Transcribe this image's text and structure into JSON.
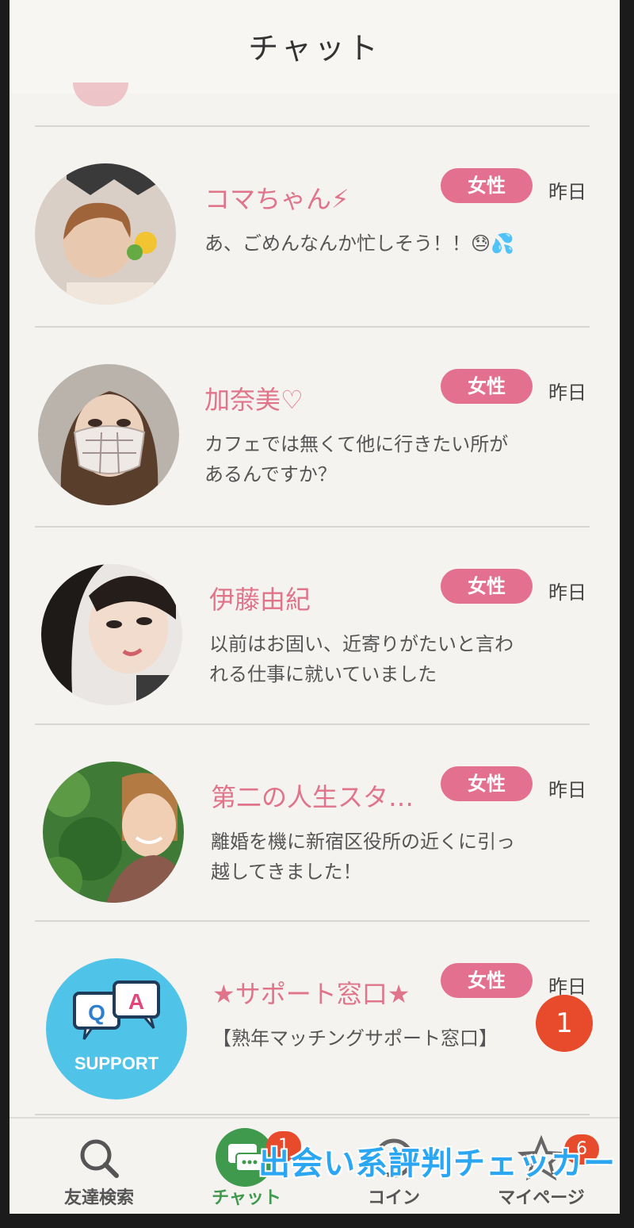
{
  "header": {
    "title": "チャット"
  },
  "badge_label": "女性",
  "chats": [
    {
      "name": "コマちゃん⚡",
      "date": "昨日",
      "message": "あ、ごめんなんか忙しそう！！😓💦"
    },
    {
      "name": "加奈美♡",
      "date": "昨日",
      "message": "カフェでは無くて他に行きたい所があるんですか？"
    },
    {
      "name": "伊藤由紀",
      "date": "昨日",
      "message": "以前はお固い、近寄りがたいと言われる仕事に就いていました"
    },
    {
      "name": "第二の人生スタ…",
      "date": "昨日",
      "message": "離婚を機に新宿区役所の近くに引っ越してきました！"
    },
    {
      "name": "★サポート窓口★",
      "date": "昨日",
      "message": "【熟年マッチングサポート窓口】",
      "unread": "1",
      "avatar_text": "SUPPORT"
    }
  ],
  "tabs": [
    {
      "label": "友達検索",
      "icon": "search-icon"
    },
    {
      "label": "チャット",
      "icon": "chat-icon",
      "badge": "1"
    },
    {
      "label": "コイン",
      "icon": "coin-icon"
    },
    {
      "label": "マイページ",
      "icon": "star-icon",
      "badge": "6"
    }
  ],
  "watermark": "出会い系評判チェッカー",
  "colors": {
    "accent": "#e3708f",
    "name": "#e0748a",
    "unread": "#e84a2c",
    "active_tab": "#3f9a4e"
  }
}
